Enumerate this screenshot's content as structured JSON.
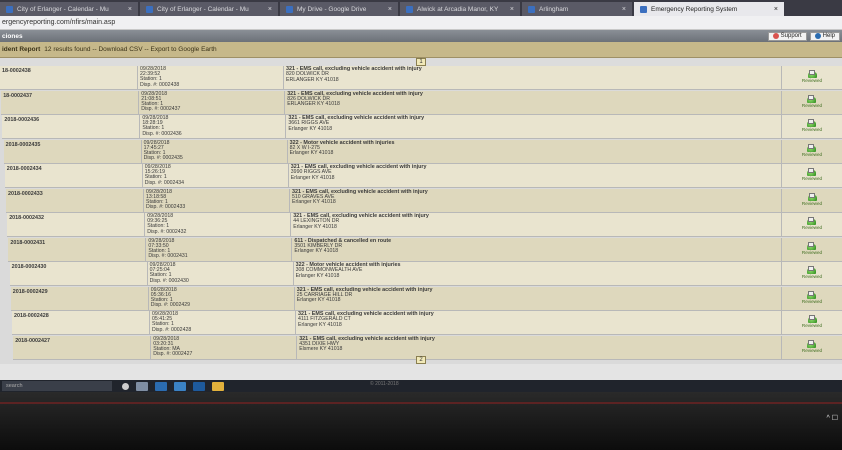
{
  "browser": {
    "tabs": [
      {
        "label": "City of Erlanger - Calendar - Mu",
        "active": false
      },
      {
        "label": "City of Erlanger - Calendar - Mu",
        "active": false
      },
      {
        "label": "My Drive - Google Drive",
        "active": false
      },
      {
        "label": "Alwick at Arcadia Manor, KY",
        "active": false
      },
      {
        "label": "Arlingham",
        "active": false
      },
      {
        "label": "Emergency Reporting System",
        "active": true
      }
    ],
    "url": "ergencyreporting.com/nfirs/main.asp"
  },
  "appbar": {
    "left_label": "ciones",
    "support_label": "Support",
    "help_label": "Help"
  },
  "report": {
    "title": "ident Report",
    "summary": "12 results found -- Download CSV -- Export to Google Earth",
    "page_top": "1",
    "page_bottom": "2"
  },
  "incidents": [
    {
      "id": "18-0002438",
      "date": "09/28/2018",
      "time": "22:39:52",
      "station": "Station: 1",
      "disp": "Disp. #: 0002438",
      "nature": "321 - EMS call, excluding vehicle accident with injury",
      "addr1": "820 DOLWICK DR",
      "addr2": "ERLANGER KY 41018",
      "status": "Reviewed"
    },
    {
      "id": "18-0002437",
      "date": "09/28/2018",
      "time": "21:08:51",
      "station": "Station: 1",
      "disp": "Disp. #: 0002437",
      "nature": "321 - EMS call, excluding vehicle accident with injury",
      "addr1": "826 DOLWICK DR",
      "addr2": "ERLANGER KY 41018",
      "status": "Reviewed"
    },
    {
      "id": "2018-0002436",
      "date": "09/28/2018",
      "time": "18:28:19",
      "station": "Station: 1",
      "disp": "Disp. #: 0002436",
      "nature": "321 - EMS call, excluding vehicle accident with injury",
      "addr1": "3661 RIGGS AVE",
      "addr2": "Erlanger KY 41018",
      "status": "Reviewed"
    },
    {
      "id": "2018-0002435",
      "date": "09/28/2018",
      "time": "17:45:27",
      "station": "Station: 1",
      "disp": "Disp. #: 0002435",
      "nature": "322 - Motor vehicle accident with injuries",
      "addr1": "82 X W I-275",
      "addr2": "Erlanger KY 41018",
      "status": "Reviewed"
    },
    {
      "id": "2018-0002434",
      "date": "09/28/2018",
      "time": "15:26:19",
      "station": "Station: 1",
      "disp": "Disp. #: 0002434",
      "nature": "321 - EMS call, excluding vehicle accident with injury",
      "addr1": "3990 RIGGS AVE",
      "addr2": "Erlanger KY 41018",
      "status": "Reviewed"
    },
    {
      "id": "2018-0002433",
      "date": "09/28/2018",
      "time": "13:18:58",
      "station": "Station: 1",
      "disp": "Disp. #: 0002433",
      "nature": "321 - EMS call, excluding vehicle accident with injury",
      "addr1": "510 GRAVES AVE",
      "addr2": "Erlanger KY 41018",
      "status": "Reviewed"
    },
    {
      "id": "2018-0002432",
      "date": "09/28/2018",
      "time": "09:36:25",
      "station": "Station: 1",
      "disp": "Disp. #: 0002432",
      "nature": "321 - EMS call, excluding vehicle accident with injury",
      "addr1": "44 LEXINGTON DR",
      "addr2": "Erlanger KY 41018",
      "status": "Reviewed"
    },
    {
      "id": "2018-0002431",
      "date": "09/28/2018",
      "time": "07:33:50",
      "station": "Station: 1",
      "disp": "Disp. #: 0002431",
      "nature": "611 - Dispatched & cancelled en route",
      "addr1": "3501 KIMBERLY DR",
      "addr2": "Erlanger KY 41018",
      "status": "Reviewed"
    },
    {
      "id": "2018-0002430",
      "date": "09/28/2018",
      "time": "07:25:04",
      "station": "Station: 1",
      "disp": "Disp. #: 0002430",
      "nature": "322 - Motor vehicle accident with injuries",
      "addr1": "308 COMMONWEALTH AVE",
      "addr2": "Erlanger KY 41018",
      "status": "Reviewed"
    },
    {
      "id": "2018-0002429",
      "date": "09/28/2018",
      "time": "05:36:16",
      "station": "Station: 1",
      "disp": "Disp. #: 0002429",
      "nature": "321 - EMS call, excluding vehicle accident with injury",
      "addr1": "25 CARRIAGE HILL DR",
      "addr2": "Erlanger KY 41018",
      "status": "Reviewed"
    },
    {
      "id": "2018-0002428",
      "date": "09/28/2018",
      "time": "05:41:25",
      "station": "Station: 1",
      "disp": "Disp. #: 0002428",
      "nature": "321 - EMS call, excluding vehicle accident with injury",
      "addr1": "4111 FITZGERALD CT",
      "addr2": "Erlanger KY 41018",
      "status": "Reviewed"
    },
    {
      "id": "2018-0002427",
      "date": "09/28/2018",
      "time": "03:20:31",
      "station": "Station: MA",
      "disp": "Disp. #: 0002427",
      "nature": "321 - EMS call, excluding vehicle accident with injury",
      "addr1": "4351 DIXIE HWY",
      "addr2": "Elsmere KY 41018",
      "status": "Reviewed"
    }
  ],
  "taskbar": {
    "search_placeholder": "search",
    "status_text": "© 2011-2018",
    "tray": "^ ☐"
  },
  "colors": {
    "row_odd": "#e9e4cf",
    "row_even": "#ded8bd",
    "report_bar": "#c6b88a",
    "reviewed_green": "#2d8a1e"
  }
}
